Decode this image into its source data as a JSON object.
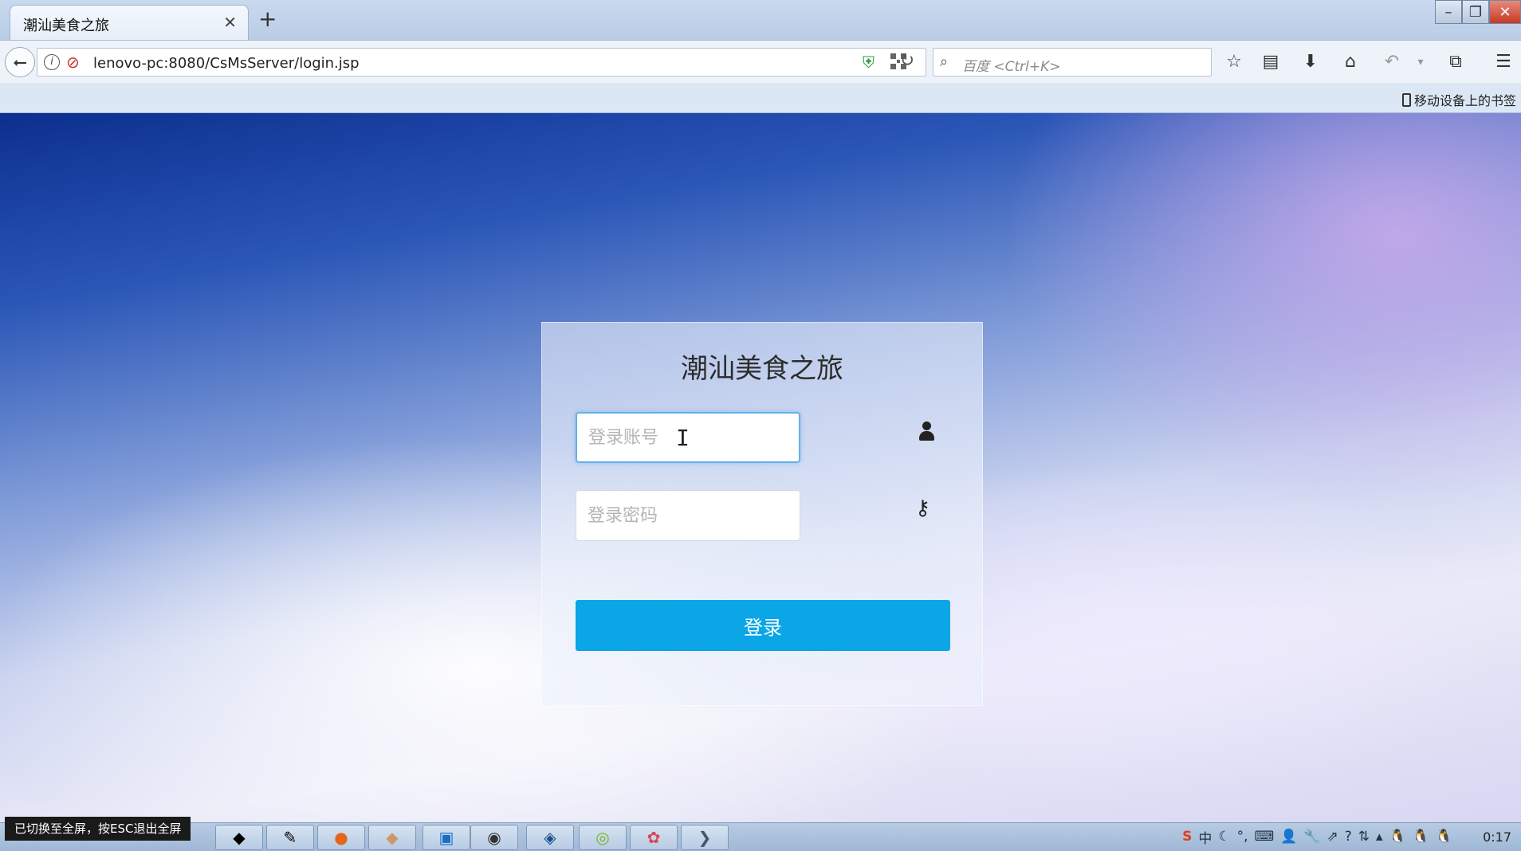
{
  "browser": {
    "tab_title": "潮汕美食之旅",
    "tab_close": "✕",
    "new_tab": "+",
    "url": "lenovo-pc:8080/CsMsServer/login.jsp",
    "search_placeholder": "百度 <Ctrl+K>",
    "mobile_bookmarks": "移动设备上的书签",
    "icons": [
      "back-icon",
      "info-icon",
      "blocked-icon",
      "shield-icon",
      "qr-code-icon",
      "reload-icon",
      "search-icon",
      "star-icon",
      "reading-list-icon",
      "download-icon",
      "home-icon",
      "undo-icon",
      "screenshot-icon",
      "menu-icon"
    ]
  },
  "login": {
    "title": "潮汕美食之旅",
    "account_placeholder": "登录账号",
    "password_placeholder": "登录密码",
    "submit_label": "登录",
    "accent_color": "#0aa6e6"
  },
  "fullscreen_notice": "已切换至全屏，按ESC退出全屏",
  "taskbar": {
    "clock": "0:17",
    "tray_ime": "中"
  }
}
